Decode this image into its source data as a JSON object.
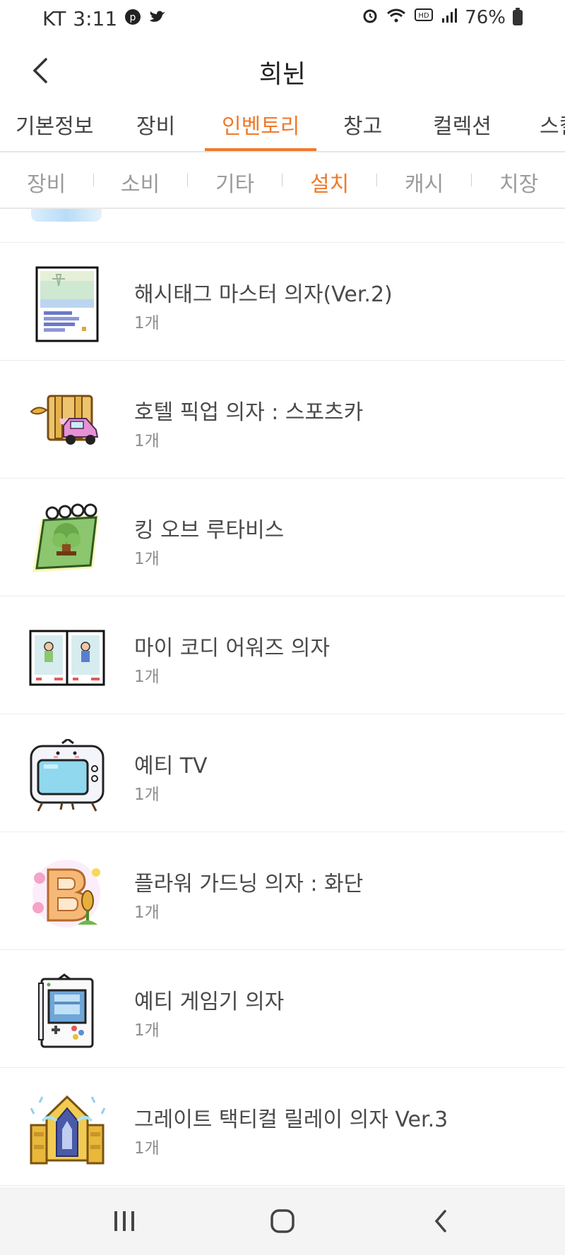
{
  "status": {
    "carrier": "KT",
    "time": "3:11",
    "battery": "76%",
    "hd_badge": "HD"
  },
  "appbar": {
    "title": "희뉜"
  },
  "tabs": [
    {
      "label": "기본정보"
    },
    {
      "label": "장비"
    },
    {
      "label": "인벤토리"
    },
    {
      "label": "창고"
    },
    {
      "label": "컬렉션"
    },
    {
      "label": "스킬"
    }
  ],
  "subtabs": [
    {
      "label": "장비"
    },
    {
      "label": "소비"
    },
    {
      "label": "기타"
    },
    {
      "label": "설치"
    },
    {
      "label": "캐시"
    },
    {
      "label": "치장"
    }
  ],
  "items": [
    {
      "name": "해시태그 마스터 의자(Ver.2)",
      "count": "1개",
      "icon": "hashtag-chair-icon"
    },
    {
      "name": "호텔 픽업 의자 : 스포츠카",
      "count": "1개",
      "icon": "sportscar-chair-icon"
    },
    {
      "name": "킹 오브 루타비스",
      "count": "1개",
      "icon": "book-chair-icon"
    },
    {
      "name": "마이 코디 어워즈 의자",
      "count": "1개",
      "icon": "award-cards-icon"
    },
    {
      "name": "예티 TV",
      "count": "1개",
      "icon": "yeti-tv-icon"
    },
    {
      "name": "플라워 가드닝 의자 : 화단",
      "count": "1개",
      "icon": "flower-b-icon"
    },
    {
      "name": "예티 게임기 의자",
      "count": "1개",
      "icon": "yeti-gameboy-icon"
    },
    {
      "name": "그레이트 택티컬 릴레이 의자 Ver.3",
      "count": "1개",
      "icon": "golden-throne-icon"
    }
  ],
  "colors": {
    "accent": "#f07a2a",
    "text": "#4a4a4a",
    "muted": "#9b9b9b"
  }
}
